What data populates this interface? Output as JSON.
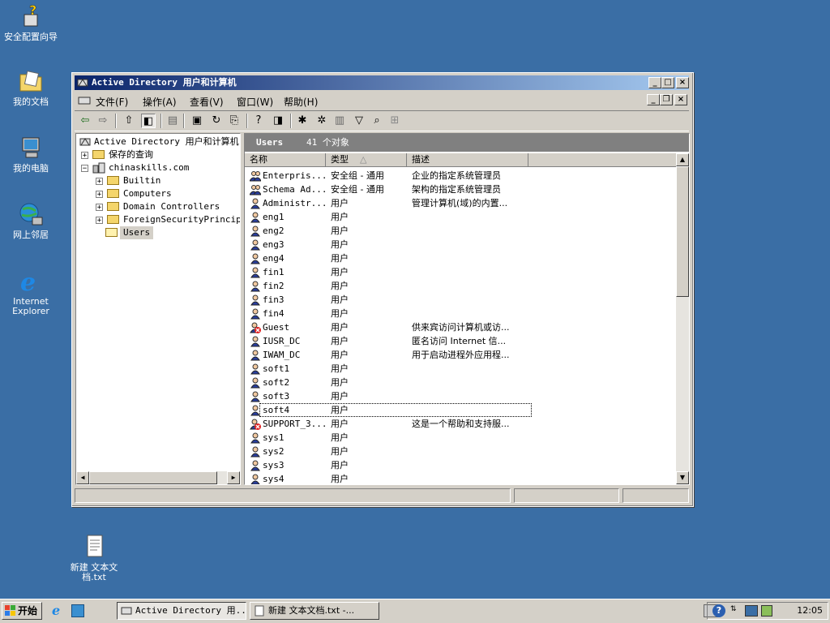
{
  "desktop": {
    "icons": [
      {
        "label": "安全配置向导"
      },
      {
        "label": "我的文档"
      },
      {
        "label": "我的电脑"
      },
      {
        "label": "网上邻居"
      },
      {
        "label": "Internet Explorer"
      },
      {
        "label": "新建 文本文档.txt"
      }
    ]
  },
  "window": {
    "title": "Active Directory 用户和计算机",
    "menu": [
      "文件(F)",
      "操作(A)",
      "查看(V)",
      "窗口(W)",
      "帮助(H)"
    ],
    "tree": {
      "root": "Active Directory 用户和计算机",
      "items": [
        {
          "label": "保存的查询"
        },
        {
          "label": "chinaskills.com"
        },
        {
          "label": "Builtin"
        },
        {
          "label": "Computers"
        },
        {
          "label": "Domain Controllers"
        },
        {
          "label": "ForeignSecurityPrincipa"
        },
        {
          "label": "Users"
        }
      ]
    },
    "pane": {
      "title": "Users",
      "count": "41 个对象",
      "columns": [
        "名称",
        "类型",
        "描述"
      ],
      "rows": [
        {
          "name": "Enterpris...",
          "type": "安全组 - 通用",
          "desc": "企业的指定系统管理员",
          "icon": "group-icon"
        },
        {
          "name": "Schema Ad...",
          "type": "安全组 - 通用",
          "desc": "架构的指定系统管理员",
          "icon": "group-icon"
        },
        {
          "name": "Administr...",
          "type": "用户",
          "desc": "管理计算机(域)的内置...",
          "icon": "user-icon"
        },
        {
          "name": "eng1",
          "type": "用户",
          "desc": "",
          "icon": "user-icon"
        },
        {
          "name": "eng2",
          "type": "用户",
          "desc": "",
          "icon": "user-icon"
        },
        {
          "name": "eng3",
          "type": "用户",
          "desc": "",
          "icon": "user-icon"
        },
        {
          "name": "eng4",
          "type": "用户",
          "desc": "",
          "icon": "user-icon"
        },
        {
          "name": "fin1",
          "type": "用户",
          "desc": "",
          "icon": "user-icon"
        },
        {
          "name": "fin2",
          "type": "用户",
          "desc": "",
          "icon": "user-icon"
        },
        {
          "name": "fin3",
          "type": "用户",
          "desc": "",
          "icon": "user-icon"
        },
        {
          "name": "fin4",
          "type": "用户",
          "desc": "",
          "icon": "user-icon"
        },
        {
          "name": "Guest",
          "type": "用户",
          "desc": "供来宾访问计算机或访...",
          "icon": "disabled-user-icon"
        },
        {
          "name": "IUSR_DC",
          "type": "用户",
          "desc": "匿名访问 Internet 信...",
          "icon": "user-icon"
        },
        {
          "name": "IWAM_DC",
          "type": "用户",
          "desc": "用于启动进程外应用程...",
          "icon": "user-icon"
        },
        {
          "name": "soft1",
          "type": "用户",
          "desc": "",
          "icon": "user-icon"
        },
        {
          "name": "soft2",
          "type": "用户",
          "desc": "",
          "icon": "user-icon"
        },
        {
          "name": "soft3",
          "type": "用户",
          "desc": "",
          "icon": "user-icon"
        },
        {
          "name": "soft4",
          "type": "用户",
          "desc": "",
          "icon": "user-icon"
        },
        {
          "name": "SUPPORT_3...",
          "type": "用户",
          "desc": "这是一个帮助和支持服...",
          "icon": "disabled-user-icon"
        },
        {
          "name": "sys1",
          "type": "用户",
          "desc": "",
          "icon": "user-icon"
        },
        {
          "name": "sys2",
          "type": "用户",
          "desc": "",
          "icon": "user-icon"
        },
        {
          "name": "sys3",
          "type": "用户",
          "desc": "",
          "icon": "user-icon"
        },
        {
          "name": "sys4",
          "type": "用户",
          "desc": "",
          "icon": "user-icon"
        }
      ]
    }
  },
  "taskbar": {
    "start": "开始",
    "tasks": [
      "Active Directory 用...",
      "新建 文本文档.txt -..."
    ],
    "clock": "12:05"
  }
}
